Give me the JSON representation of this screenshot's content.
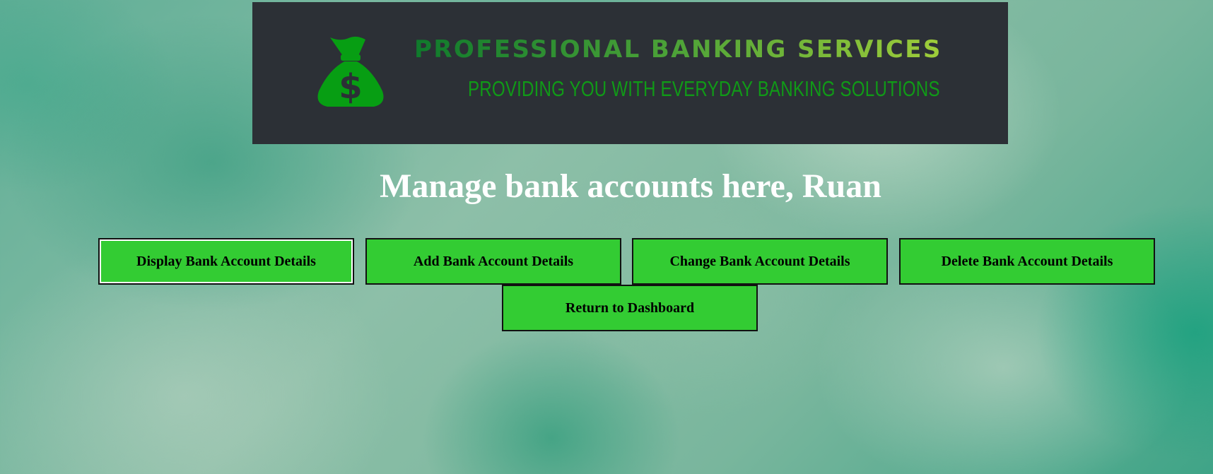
{
  "banner": {
    "logo_icon": "money-bag-dollar-icon",
    "title": "PROFESSIONAL BANKING SERVICES",
    "subtitle": "PROVIDING YOU WITH EVERYDAY BANKING SOLUTIONS",
    "background_color": "#2c3036",
    "title_gradient": [
      "#0f7a2c",
      "#9fcd3a"
    ],
    "subtitle_color": "#109a17"
  },
  "heading": "Manage bank accounts here, Ruan",
  "buttons": {
    "display": "Display Bank Account Details",
    "add": "Add Bank Account Details",
    "change": "Change Bank Account Details",
    "delete": "Delete Bank Account Details",
    "return": "Return to Dashboard"
  },
  "colors": {
    "button_background": "#33cc33",
    "button_border": "#111111",
    "heading_text": "#ffffff"
  }
}
